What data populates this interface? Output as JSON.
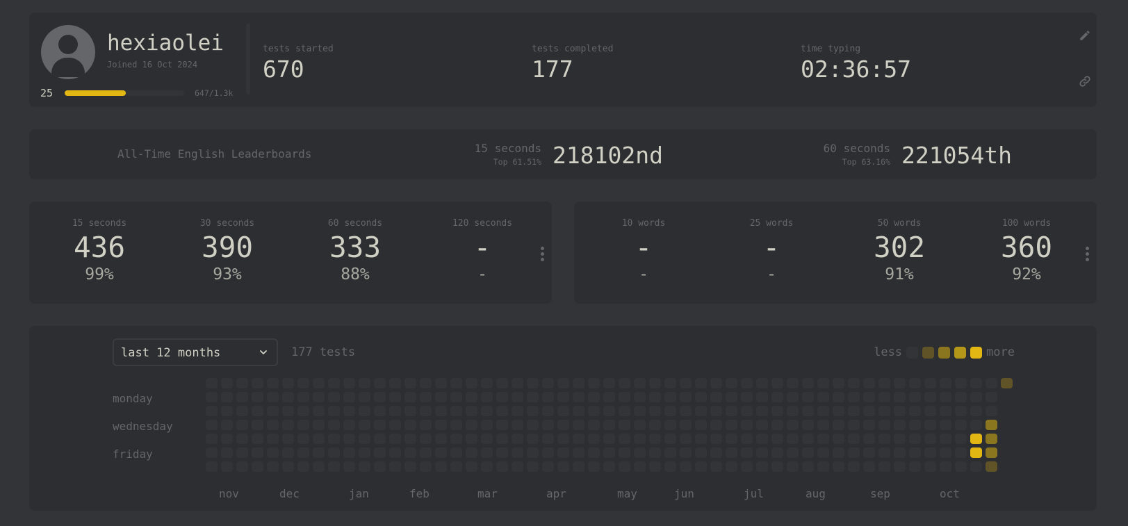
{
  "profile": {
    "username": "hexiaolei",
    "joined": "Joined 16 Oct 2024",
    "level": "25",
    "xp_text": "647/1.3k",
    "xp_progress": 0.51,
    "stats": [
      {
        "label": "tests started",
        "value": "670"
      },
      {
        "label": "tests completed",
        "value": "177"
      },
      {
        "label": "time typing",
        "value": "02:36:57"
      }
    ],
    "icons": {
      "edit": "pencil-icon",
      "share": "link-icon"
    }
  },
  "leaderboard": {
    "title": "All-Time English Leaderboards",
    "entries": [
      {
        "mode": "15 seconds",
        "top": "Top 61.51%",
        "rank": "218102nd"
      },
      {
        "mode": "60 seconds",
        "top": "Top 63.16%",
        "rank": "221054th"
      }
    ]
  },
  "pb_time": [
    {
      "label": "15 seconds",
      "wpm": "436",
      "acc": "99%"
    },
    {
      "label": "30 seconds",
      "wpm": "390",
      "acc": "93%"
    },
    {
      "label": "60 seconds",
      "wpm": "333",
      "acc": "88%"
    },
    {
      "label": "120 seconds",
      "wpm": "-",
      "acc": "-"
    }
  ],
  "pb_words": [
    {
      "label": "10 words",
      "wpm": "-",
      "acc": "-"
    },
    {
      "label": "25 words",
      "wpm": "-",
      "acc": "-"
    },
    {
      "label": "50 words",
      "wpm": "302",
      "acc": "91%"
    },
    {
      "label": "100 words",
      "wpm": "360",
      "acc": "92%"
    }
  ],
  "activity": {
    "range": "last 12 months",
    "count": "177 tests",
    "legend_less": "less",
    "legend_more": "more",
    "days": [
      "monday",
      "wednesday",
      "friday"
    ],
    "months": [
      "nov",
      "dec",
      "jan",
      "feb",
      "mar",
      "apr",
      "may",
      "jun",
      "jul",
      "aug",
      "sep",
      "oct"
    ],
    "colors": {
      "empty": "#323437",
      "l1": "#5f5327",
      "l2": "#8b7620",
      "l3": "#b49719",
      "l4": "#e2b714"
    },
    "weeks": 53,
    "active_cells": [
      {
        "week": 52,
        "day": 0,
        "level": "l1"
      },
      {
        "week": 51,
        "day": 3,
        "level": "l2"
      },
      {
        "week": 50,
        "day": 4,
        "level": "l4"
      },
      {
        "week": 51,
        "day": 4,
        "level": "l2"
      },
      {
        "week": 50,
        "day": 5,
        "level": "l4"
      },
      {
        "week": 51,
        "day": 5,
        "level": "l2"
      },
      {
        "week": 51,
        "day": 6,
        "level": "l1"
      }
    ]
  }
}
